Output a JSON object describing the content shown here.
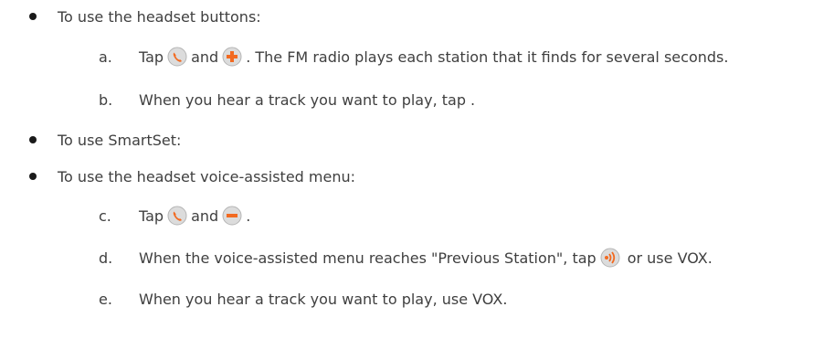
{
  "bullets": [
    {
      "text": "To use the headset buttons:"
    },
    {
      "text": "To use SmartSet:"
    },
    {
      "text": "To use the headset voice-assisted menu:"
    }
  ],
  "steps": {
    "a": {
      "marker": "a.",
      "pre": "Tap",
      "mid": "and",
      "post": ". The FM radio plays each station that it finds for several seconds.",
      "icons": [
        "call-button-icon",
        "volume-up-plus-icon"
      ]
    },
    "b": {
      "marker": "b.",
      "text": "When you hear a track you want to play, tap ."
    },
    "c": {
      "marker": "c.",
      "pre": "Tap",
      "mid": "and",
      "post": ".",
      "icons": [
        "call-button-icon",
        "volume-down-minus-icon"
      ]
    },
    "d": {
      "marker": "d.",
      "pre": "When the voice-assisted menu reaches \"Previous Station\", tap",
      "post": "or use VOX.",
      "icons": [
        "voice-button-icon"
      ]
    },
    "e": {
      "marker": "e.",
      "text": "When you hear a track you want to play, use VOX."
    }
  },
  "colors": {
    "text": "#3f3f3f",
    "icon_orange": "#f26a21",
    "icon_grey": "#d9d9d9"
  }
}
